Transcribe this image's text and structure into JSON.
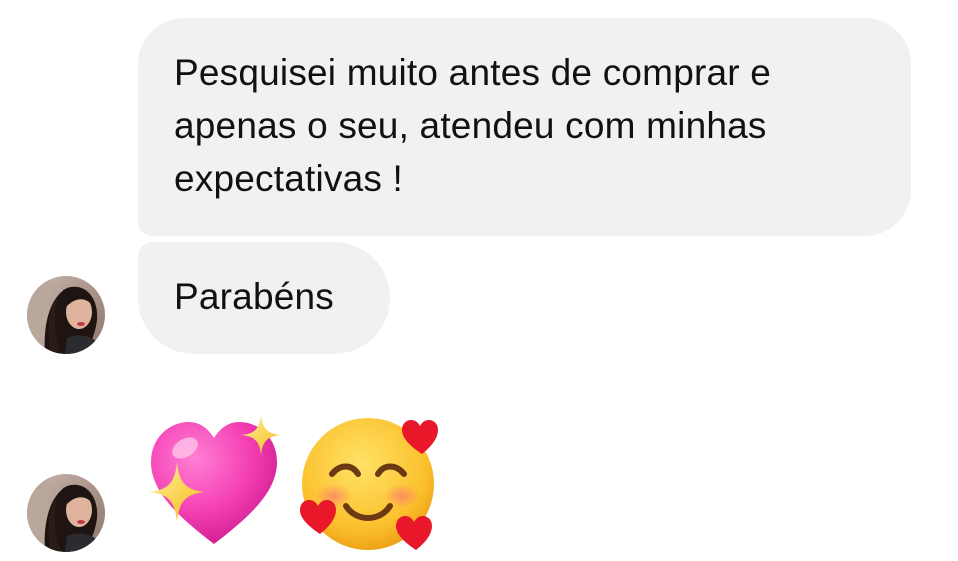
{
  "messages": [
    {
      "lines": [
        "Pesquisei muito antes de comprar e",
        "apenas o seu, atendeu com minhas",
        "expectativas !"
      ]
    },
    {
      "text": "Parabéns"
    }
  ],
  "reaction": {
    "emojis": [
      "sparkling-heart-icon",
      "smiling-face-with-hearts-icon"
    ]
  },
  "colors": {
    "bubble_background": "#f0f1f3",
    "text": "#111111"
  }
}
